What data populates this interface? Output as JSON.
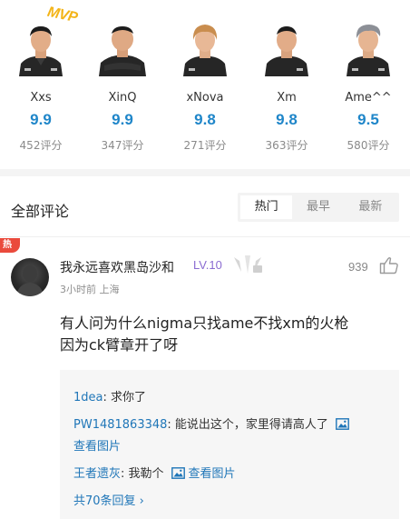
{
  "players": [
    {
      "name": "Xxs",
      "score": "9.9",
      "count": "452评分",
      "mvp": "MVP"
    },
    {
      "name": "XinQ",
      "score": "9.9",
      "count": "347评分"
    },
    {
      "name": "xNova",
      "score": "9.8",
      "count": "271评分"
    },
    {
      "name": "Xm",
      "score": "9.8",
      "count": "363评分"
    },
    {
      "name": "Ame^^",
      "score": "9.5",
      "count": "580评分"
    }
  ],
  "comments_section": {
    "title": "全部评论",
    "sort_tabs": [
      "热门",
      "最早",
      "最新"
    ],
    "active_sort": "热门"
  },
  "comment": {
    "badge": "热",
    "username": "我永远喜欢黑岛沙和",
    "level": "LV.10",
    "meta": "3小时前 上海",
    "likes": "939",
    "text_lines": [
      "有人问为什么nigma只找ame不找xm的火枪",
      "因为ck臂章开了呀"
    ]
  },
  "replies": {
    "items": [
      {
        "name": "1dea",
        "sep": ": ",
        "text": "求你了"
      },
      {
        "name": "PW1481863348",
        "sep": ": ",
        "text": "能说出这个，家里得请高人了",
        "link": "查看图片"
      },
      {
        "name": "王者遗灰",
        "sep": ": ",
        "text": "我勒个",
        "link": "查看图片"
      }
    ],
    "more": "共70条回复 ›"
  },
  "colors": {
    "accent": "#1f86c9",
    "link": "#1f76b8",
    "level": "#8a6bd1",
    "hot": "#ea4a3c",
    "mvp": "#f3b418"
  }
}
